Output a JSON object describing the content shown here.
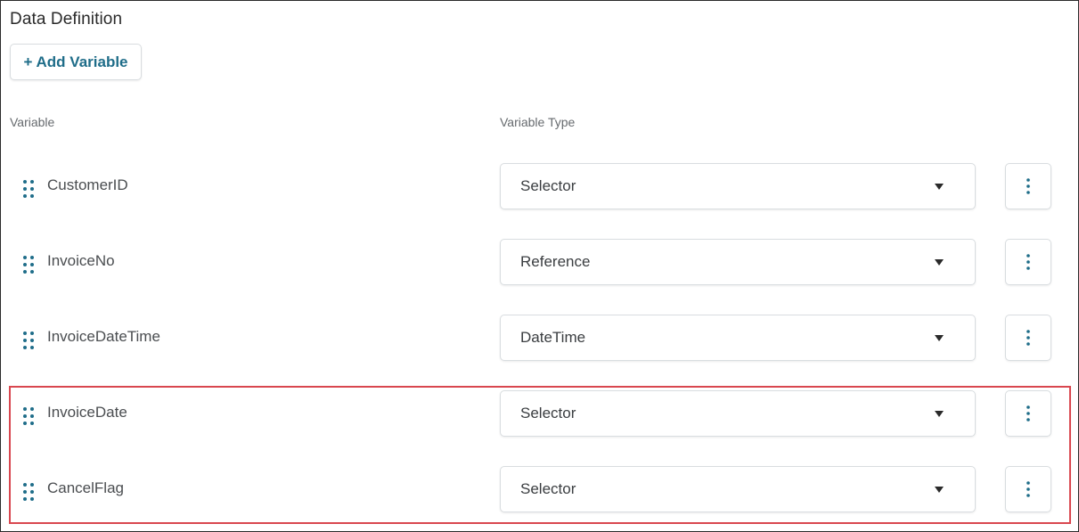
{
  "section": {
    "title": "Data Definition",
    "add_button_label": "+ Add Variable"
  },
  "columns": {
    "variable": "Variable",
    "variable_type": "Variable Type"
  },
  "variables": [
    {
      "name": "CustomerID",
      "type": "Selector"
    },
    {
      "name": "InvoiceNo",
      "type": "Reference"
    },
    {
      "name": "InvoiceDateTime",
      "type": "DateTime"
    },
    {
      "name": "InvoiceDate",
      "type": "Selector"
    },
    {
      "name": "CancelFlag",
      "type": "Selector"
    }
  ],
  "highlighted_rows": [
    3,
    4
  ],
  "colors": {
    "accent": "#1f6d89",
    "highlight_border": "#d9474f",
    "control_border": "#d9dde0"
  },
  "icons": {
    "drag": "drag-handle-icon",
    "more": "more-vertical-icon",
    "dropdown": "caret-down-icon"
  }
}
